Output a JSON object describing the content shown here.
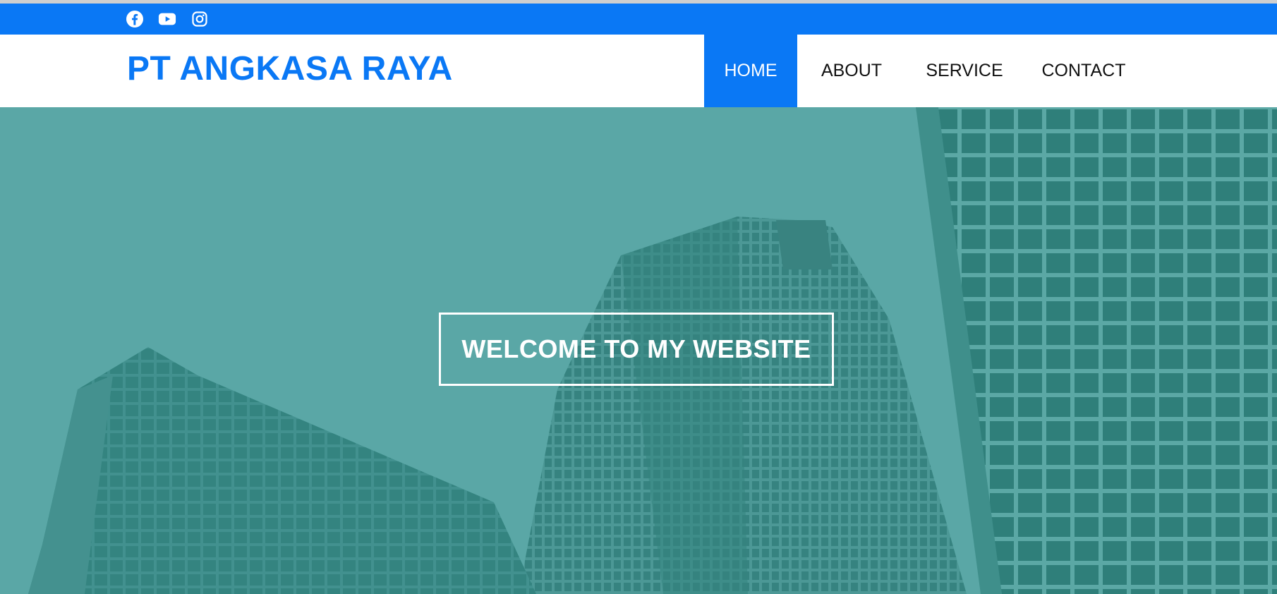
{
  "social": {
    "icons": [
      "facebook-icon",
      "youtube-icon",
      "instagram-icon"
    ],
    "bar_color": "#0a78f5"
  },
  "header": {
    "brand": "PT ANGKASA RAYA",
    "brand_color": "#0a78f5"
  },
  "nav": {
    "items": [
      {
        "label": "HOME",
        "active": true
      },
      {
        "label": "ABOUT",
        "active": false
      },
      {
        "label": "SERVICE",
        "active": false
      },
      {
        "label": "CONTACT",
        "active": false
      }
    ],
    "active_color": "#0a78f5"
  },
  "hero": {
    "welcome": "WELCOME TO MY WEBSITE",
    "overlay_color": "#56a6a6"
  }
}
